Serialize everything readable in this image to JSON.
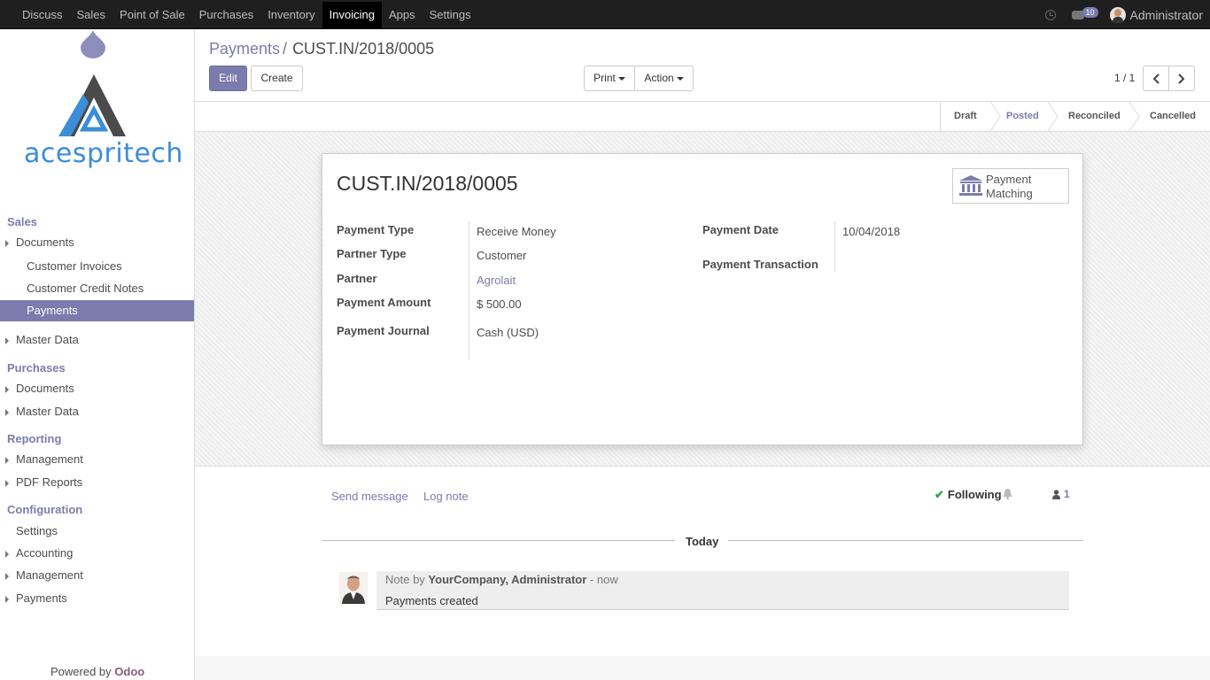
{
  "topnav": {
    "items": [
      "Discuss",
      "Sales",
      "Point of Sale",
      "Purchases",
      "Inventory",
      "Invoicing",
      "Apps",
      "Settings"
    ],
    "active": "Invoicing",
    "badge_count": "10",
    "user": "Administrator"
  },
  "sidebar": {
    "logo_text": "acespritech",
    "sections": {
      "sales": "Sales",
      "purchases": "Purchases",
      "reporting": "Reporting",
      "configuration": "Configuration"
    },
    "items": {
      "sales_documents": "Documents",
      "customer_invoices": "Customer Invoices",
      "customer_credit_notes": "Customer Credit Notes",
      "payments_active": "Payments",
      "sales_master_data": "Master Data",
      "purchases_documents": "Documents",
      "purchases_master_data": "Master Data",
      "reporting_management": "Management",
      "pdf_reports": "PDF Reports",
      "settings": "Settings",
      "accounting": "Accounting",
      "config_management": "Management",
      "config_payments": "Payments"
    },
    "powered_prefix": "Powered by ",
    "powered_brand": "Odoo"
  },
  "breadcrumb": {
    "parent": "Payments",
    "separator": "/",
    "current": "CUST.IN/2018/0005"
  },
  "toolbar": {
    "edit": "Edit",
    "create": "Create",
    "print": "Print",
    "action": "Action",
    "pager": "1 / 1"
  },
  "status": {
    "stages": [
      "Draft",
      "Posted",
      "Reconciled",
      "Cancelled"
    ],
    "active": "Posted"
  },
  "record": {
    "title": "CUST.IN/2018/0005",
    "smart_button": {
      "line1": "Payment",
      "line2": "Matching"
    },
    "fields": {
      "payment_type_label": "Payment Type",
      "payment_type_value": "Receive Money",
      "partner_type_label": "Partner Type",
      "partner_type_value": "Customer",
      "partner_label": "Partner",
      "partner_value": "Agrolait",
      "amount_label": "Payment Amount",
      "amount_value": "$ 500.00",
      "journal_label": "Payment Journal",
      "journal_value": "Cash (USD)",
      "date_label": "Payment Date",
      "date_value": "10/04/2018",
      "transaction_label": "Payment Transaction"
    }
  },
  "chatter": {
    "send_message": "Send message",
    "log_note": "Log note",
    "following": "Following",
    "followers_count": "1",
    "today": "Today",
    "message": {
      "prefix": "Note by ",
      "author": "YourCompany, Administrator",
      "time": " - now",
      "body": "Payments created"
    }
  },
  "colors": {
    "accent": "#7c7bad",
    "topbar": "#1f1f1f",
    "brand_blue": "#3b8ed8"
  }
}
